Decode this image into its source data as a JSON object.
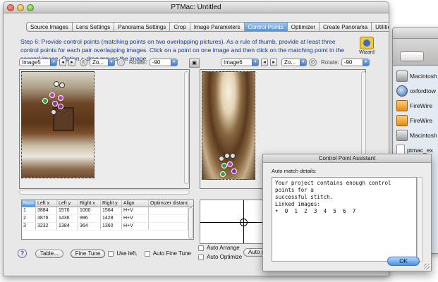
{
  "window": {
    "title": "PTMac: Untitled"
  },
  "tabs": [
    {
      "label": "Source Images",
      "active": false
    },
    {
      "label": "Lens Settings",
      "active": false
    },
    {
      "label": "Panorama Settings",
      "active": false
    },
    {
      "label": "Crop",
      "active": false
    },
    {
      "label": "Image Parameters",
      "active": false
    },
    {
      "label": "Control Points",
      "active": true
    },
    {
      "label": "Optimizer",
      "active": false
    },
    {
      "label": "Create Panorama",
      "active": false
    },
    {
      "label": "Utilities",
      "active": false
    }
  ],
  "instructions": "Step 6: Provide control points (matching points on two overlapping pictures). As a rule of thumb, provide at least three control points for each pair overlapping images. Click on a point on one image and then click on the matching point in the second image. Option + drag moves the image.",
  "wizard_label": "Wizard",
  "left_panel": {
    "image_select": "Image5",
    "zoom_select": "Zo...",
    "rotate_label": "Rotate:",
    "rotate_value": "-90"
  },
  "right_panel": {
    "image_select": "Image6",
    "zoom_select": "Zo...",
    "rotate_label": "Rotate:",
    "rotate_value": "-90"
  },
  "table": {
    "columns": [
      "Num",
      "Left x",
      "Left y",
      "Right x",
      "Right y",
      "Align",
      "Optimizer distance"
    ],
    "rows": [
      [
        "1",
        "3884",
        "1576",
        "1000",
        "1564",
        "H+V",
        ""
      ],
      [
        "2",
        "3876",
        "1436",
        "996",
        "1428",
        "H+V",
        ""
      ],
      [
        "3",
        "3232",
        "1384",
        "364",
        "1360",
        "H+V",
        ""
      ]
    ]
  },
  "bottom": {
    "help": "?",
    "table_button": "Table...",
    "fine_tune_button": "Fine Tune",
    "use_left": "Use left.",
    "auto_fine_tune": "Auto Fine Tune",
    "auto_arrange": "Auto Arrange",
    "auto_optimize": "Auto Optimize",
    "auto_match_button": "Auto mat"
  },
  "finder": {
    "items": [
      {
        "label": "Macintosh",
        "icon": "hard-drive-icon"
      },
      {
        "label": "oxfordtow",
        "icon": "globe-icon"
      },
      {
        "label": "FireWire",
        "icon": "orange-drive-icon"
      },
      {
        "label": "FireWire",
        "icon": "orange-drive-icon"
      },
      {
        "label": "Macintosh",
        "icon": "hard-drive-icon"
      },
      {
        "label": "ptmac_ex",
        "icon": "document-icon"
      }
    ]
  },
  "assistant": {
    "title": "Control Point Assistant",
    "label": "Auto match details:",
    "message": "Your project contains enough control points for a\nsuccessful stitch.\nLinked images:\n•  0  1  2  3  4  5  6  7",
    "ok": "OK"
  }
}
